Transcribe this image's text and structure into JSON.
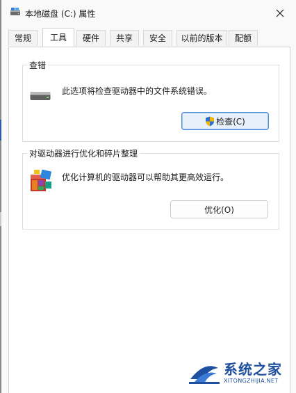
{
  "window": {
    "title": "本地磁盘 (C:) 属性",
    "close_label": "×"
  },
  "tabs": [
    {
      "label": "常规",
      "active": false
    },
    {
      "label": "工具",
      "active": true
    },
    {
      "label": "硬件",
      "active": false
    },
    {
      "label": "共享",
      "active": false
    },
    {
      "label": "安全",
      "active": false
    },
    {
      "label": "以前的版本",
      "active": false
    },
    {
      "label": "配额",
      "active": false
    }
  ],
  "error_check": {
    "title": "查错",
    "description": "此选项将检查驱动器中的文件系统错误。",
    "button_label": "检查(C)"
  },
  "optimize": {
    "title": "对驱动器进行优化和碎片整理",
    "description": "优化计算机的驱动器可以帮助其更高效运行。",
    "button_label": "优化(O)"
  },
  "watermark": {
    "title": "系统之家",
    "url": "XITONGZHIJIA.NET"
  },
  "colors": {
    "accent": "#4a8ad8",
    "watermark": "#1f4f9f"
  }
}
